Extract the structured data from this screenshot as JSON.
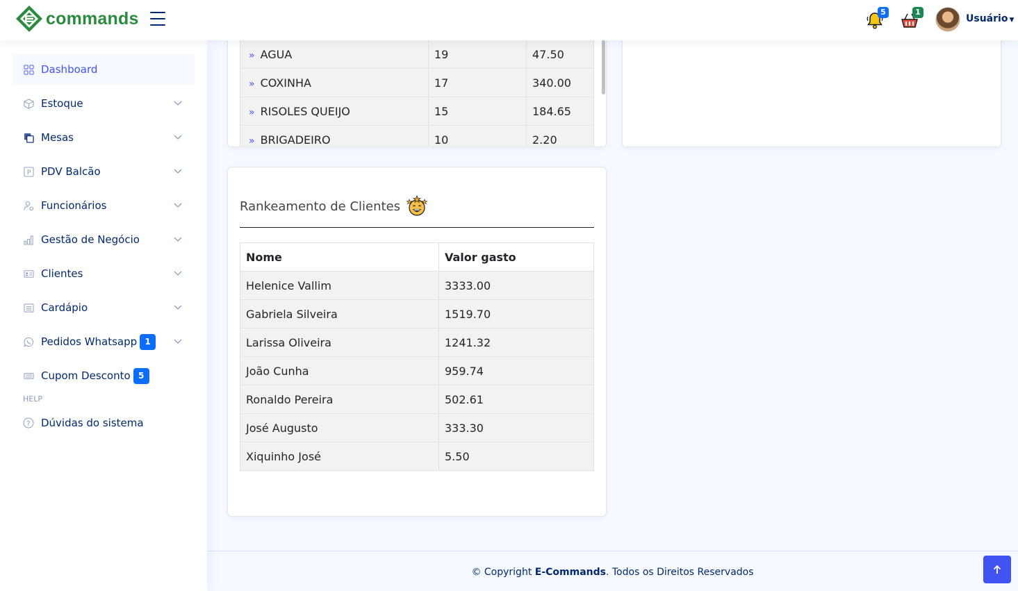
{
  "header": {
    "logo_text": "commands",
    "notifications_count": "5",
    "orders_count": "1",
    "user_name": "Usuário",
    "colors": {
      "brand_green": "#2a8a3e",
      "accent": "#4154f1",
      "badge_blue": "#0d6efd",
      "badge_green": "#198754"
    }
  },
  "sidebar": {
    "items": [
      {
        "label": "Dashboard",
        "icon": "grid-icon",
        "active": true
      },
      {
        "label": "Estoque",
        "icon": "box-icon"
      },
      {
        "label": "Mesas",
        "icon": "squares-icon"
      },
      {
        "label": "PDV Balcão",
        "icon": "p-square-icon"
      },
      {
        "label": "Funcionários",
        "icon": "person-gear-icon"
      },
      {
        "label": "Gestão de Negócio",
        "icon": "bar-chart-icon"
      },
      {
        "label": "Clientes",
        "icon": "id-card-icon"
      },
      {
        "label": "Cardápio",
        "icon": "menu-list-icon"
      },
      {
        "label": "Pedidos Whatsapp",
        "icon": "whatsapp-icon",
        "badge": "1"
      },
      {
        "label": "Cupom Desconto",
        "icon": "ticket-icon",
        "badge": "5"
      }
    ],
    "help_heading": "HELP",
    "help_item": {
      "label": "Dúvidas do sistema",
      "icon": "question-circle-icon"
    }
  },
  "products_table": {
    "rows": [
      {
        "name": "AGUA",
        "qty": "19",
        "value": "47.50"
      },
      {
        "name": "COXINHA",
        "qty": "17",
        "value": "340.00"
      },
      {
        "name": "RISOLES QUEIJO",
        "qty": "15",
        "value": "184.65"
      },
      {
        "name": "BRIGADEIRO",
        "qty": "10",
        "value": "2.20"
      }
    ]
  },
  "ranking": {
    "title": "Rankeamento de Clientes",
    "headers": [
      "Nome",
      "Valor gasto"
    ],
    "rows": [
      [
        "Helenice Vallim",
        "3333.00"
      ],
      [
        "Gabriela Silveira",
        "1519.70"
      ],
      [
        "Larissa Oliveira",
        "1241.32"
      ],
      [
        "João Cunha",
        "959.74"
      ],
      [
        "Ronaldo Pereira",
        "502.61"
      ],
      [
        "José Augusto",
        "333.30"
      ],
      [
        "Xiquinho José",
        "5.50"
      ]
    ]
  },
  "footer": {
    "prefix": "© Copyright ",
    "brand": "E-Commands",
    "suffix": ". Todos os Direitos Reservados"
  }
}
